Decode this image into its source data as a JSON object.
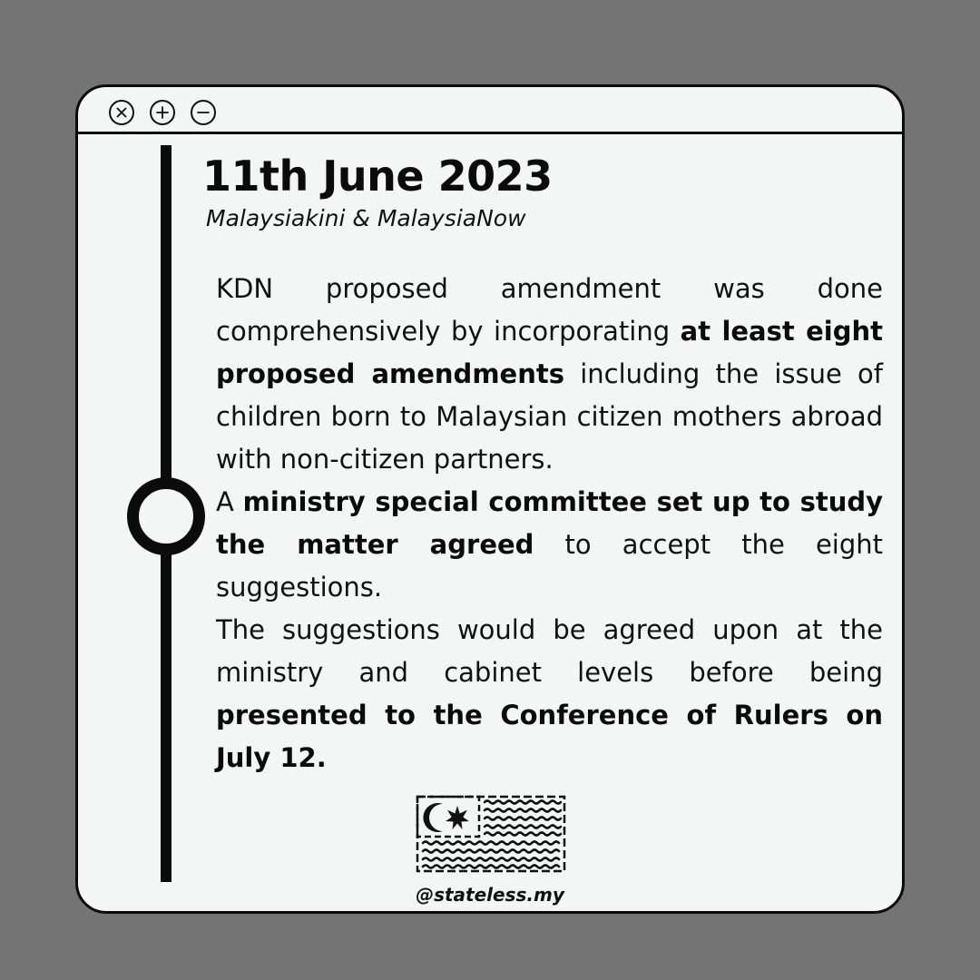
{
  "window": {
    "controls": [
      {
        "name": "close-icon"
      },
      {
        "name": "plus-icon"
      },
      {
        "name": "minus-icon"
      }
    ]
  },
  "post": {
    "date": "11th June 2023",
    "source": "Malaysiakini & MalaysiaNow",
    "paragraphs": [
      [
        {
          "text": "KDN proposed amendment was done comprehensively by incorporating ",
          "bold": false
        },
        {
          "text": "at least eight proposed amendments",
          "bold": true
        },
        {
          "text": " including the issue of children born to Malaysian citizen mothers abroad with non-citizen partners.",
          "bold": false
        }
      ],
      [
        {
          "text": "A ",
          "bold": false
        },
        {
          "text": "ministry special committee set up to study the matter agreed",
          "bold": true
        },
        {
          "text": " to accept the eight suggestions.",
          "bold": false
        }
      ],
      [
        {
          "text": "The suggestions would be agreed upon at the ministry and cabinet levels before being ",
          "bold": false
        },
        {
          "text": "presented to the Conference of Rulers on July 12.",
          "bold": true
        }
      ]
    ],
    "logo": "malaysia-flag-icon",
    "handle": "@stateless.my"
  },
  "colors": {
    "background": "#747474",
    "window": "#f4f6f5",
    "ink": "#0b0b0b"
  }
}
